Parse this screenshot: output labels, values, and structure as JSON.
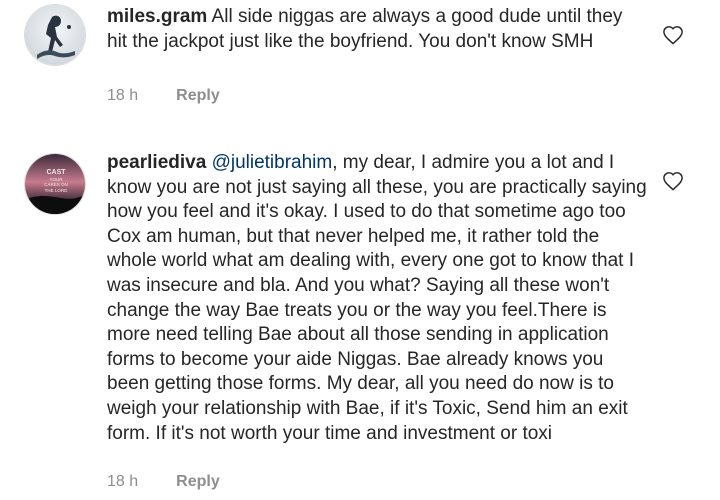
{
  "comments": [
    {
      "username": "miles.gram",
      "text": " All side niggas are always a good dude until they hit the jackpot just like the boyfriend. You don't know SMH",
      "time": "18 h",
      "reply_label": "Reply",
      "avatar_icon": "profile-avatar-miles"
    },
    {
      "username": "pearliediva",
      "mention": "@julietibrahim",
      "text": ", my dear, I admire you a lot and I know you are not just saying all these, you are practically saying how you feel and it's okay. I used to do that sometime ago too Cox am human, but that never helped me, it rather told the whole world what am dealing with, every one got to know that I was insecure and bla. And you what? Saying all these won't change the way Bae treats you or the way you feel.There is more need telling Bae about all those sending in application forms to become your aide Niggas. Bae already knows you been getting those forms. My dear, all you need do now is to weigh your relationship with Bae, if it's Toxic, Send him an exit form. If it's not worth your time and investment or toxi",
      "time": "18 h",
      "reply_label": "Reply",
      "avatar_icon": "profile-avatar-pearliediva",
      "avatar_text": "CAST YOUR CARES ON THE LORD"
    }
  ],
  "colors": {
    "text": "#262626",
    "mention": "#003569",
    "meta": "#8e8e8e"
  }
}
